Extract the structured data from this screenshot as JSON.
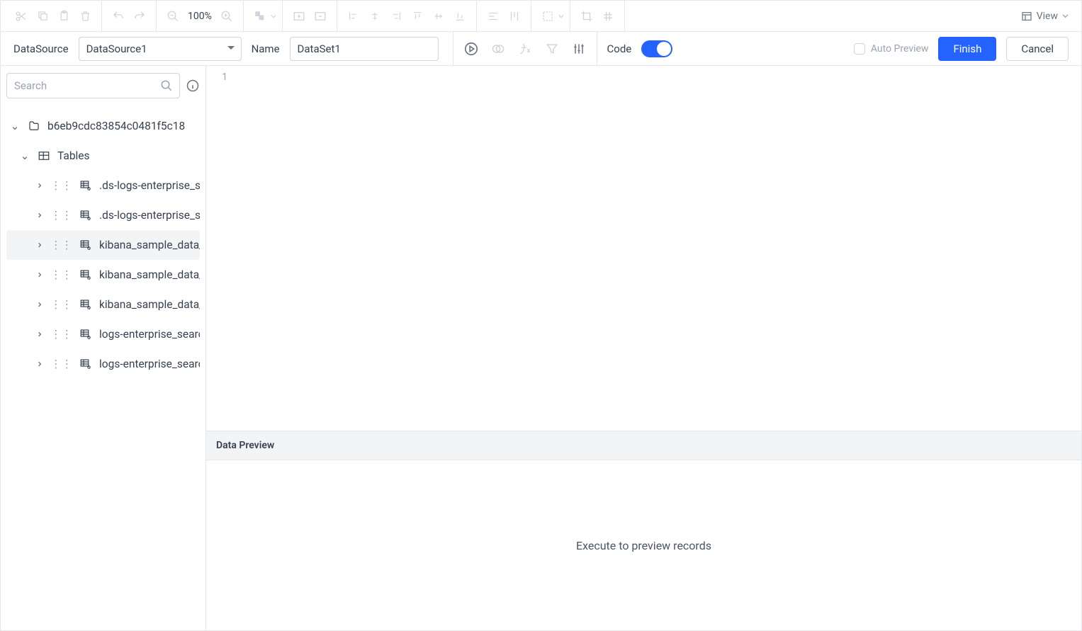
{
  "topbar": {
    "zoom": "100%",
    "view_label": "View"
  },
  "subbar": {
    "ds_label": "DataSource",
    "ds_value": "DataSource1",
    "name_label": "Name",
    "name_value": "DataSet1",
    "code_label": "Code",
    "auto_preview": "Auto Preview",
    "finish": "Finish",
    "cancel": "Cancel"
  },
  "side": {
    "search_placeholder": "Search",
    "root": "b6eb9cdc83854c0481f5c18",
    "tables_label": "Tables",
    "tables": [
      ".ds-logs-enterprise_se",
      ".ds-logs-enterprise_se",
      "kibana_sample_data_",
      "kibana_sample_data_",
      "kibana_sample_data_",
      "logs-enterprise_searc",
      "logs-enterprise_searc"
    ],
    "selected_index": 2
  },
  "editor": {
    "line": "1"
  },
  "preview": {
    "title": "Data Preview",
    "msg": "Execute to preview records"
  }
}
